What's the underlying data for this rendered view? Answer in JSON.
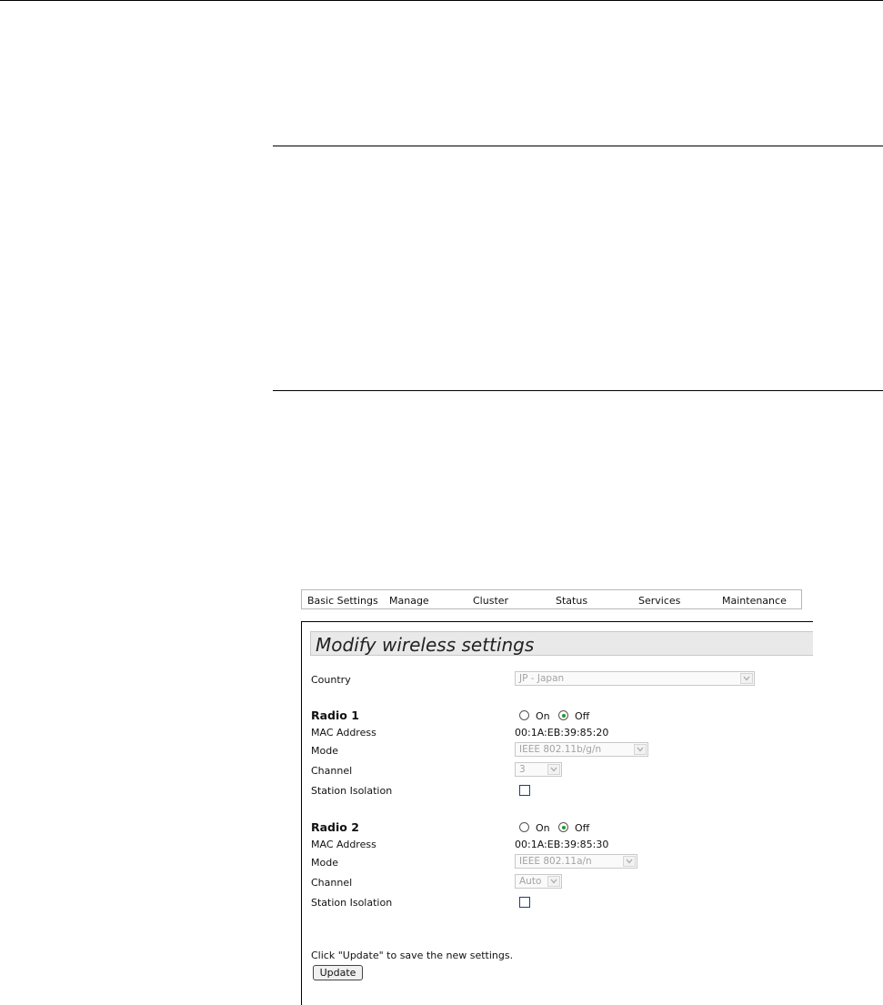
{
  "nav": {
    "items": [
      "Basic Settings",
      "Manage",
      "Cluster",
      "Status",
      "Services",
      "Maintenance"
    ]
  },
  "panel": {
    "title": "Modify wireless settings",
    "country": {
      "label": "Country",
      "value": "JP - Japan"
    },
    "radio1": {
      "heading": "Radio 1",
      "on_label": "On",
      "off_label": "Off",
      "selected": "Off",
      "mac_label": "MAC Address",
      "mac_value": "00:1A:EB:39:85:20",
      "mode_label": "Mode",
      "mode_value": "IEEE 802.11b/g/n",
      "channel_label": "Channel",
      "channel_value": "3",
      "isolation_label": "Station Isolation",
      "isolation_checked": false
    },
    "radio2": {
      "heading": "Radio 2",
      "on_label": "On",
      "off_label": "Off",
      "selected": "Off",
      "mac_label": "MAC Address",
      "mac_value": "00:1A:EB:39:85:30",
      "mode_label": "Mode",
      "mode_value": "IEEE 802.11a/n",
      "channel_label": "Channel",
      "channel_value": "Auto",
      "isolation_label": "Station Isolation",
      "isolation_checked": false
    },
    "hint": "Click \"Update\" to save the new settings.",
    "update_label": "Update"
  },
  "colors": {
    "radio_selected": "#1f9a2a",
    "checkbox_border": "#1c3f7a",
    "title_bar": "#e9e9e9",
    "disabled_text": "#a3a3a3"
  }
}
